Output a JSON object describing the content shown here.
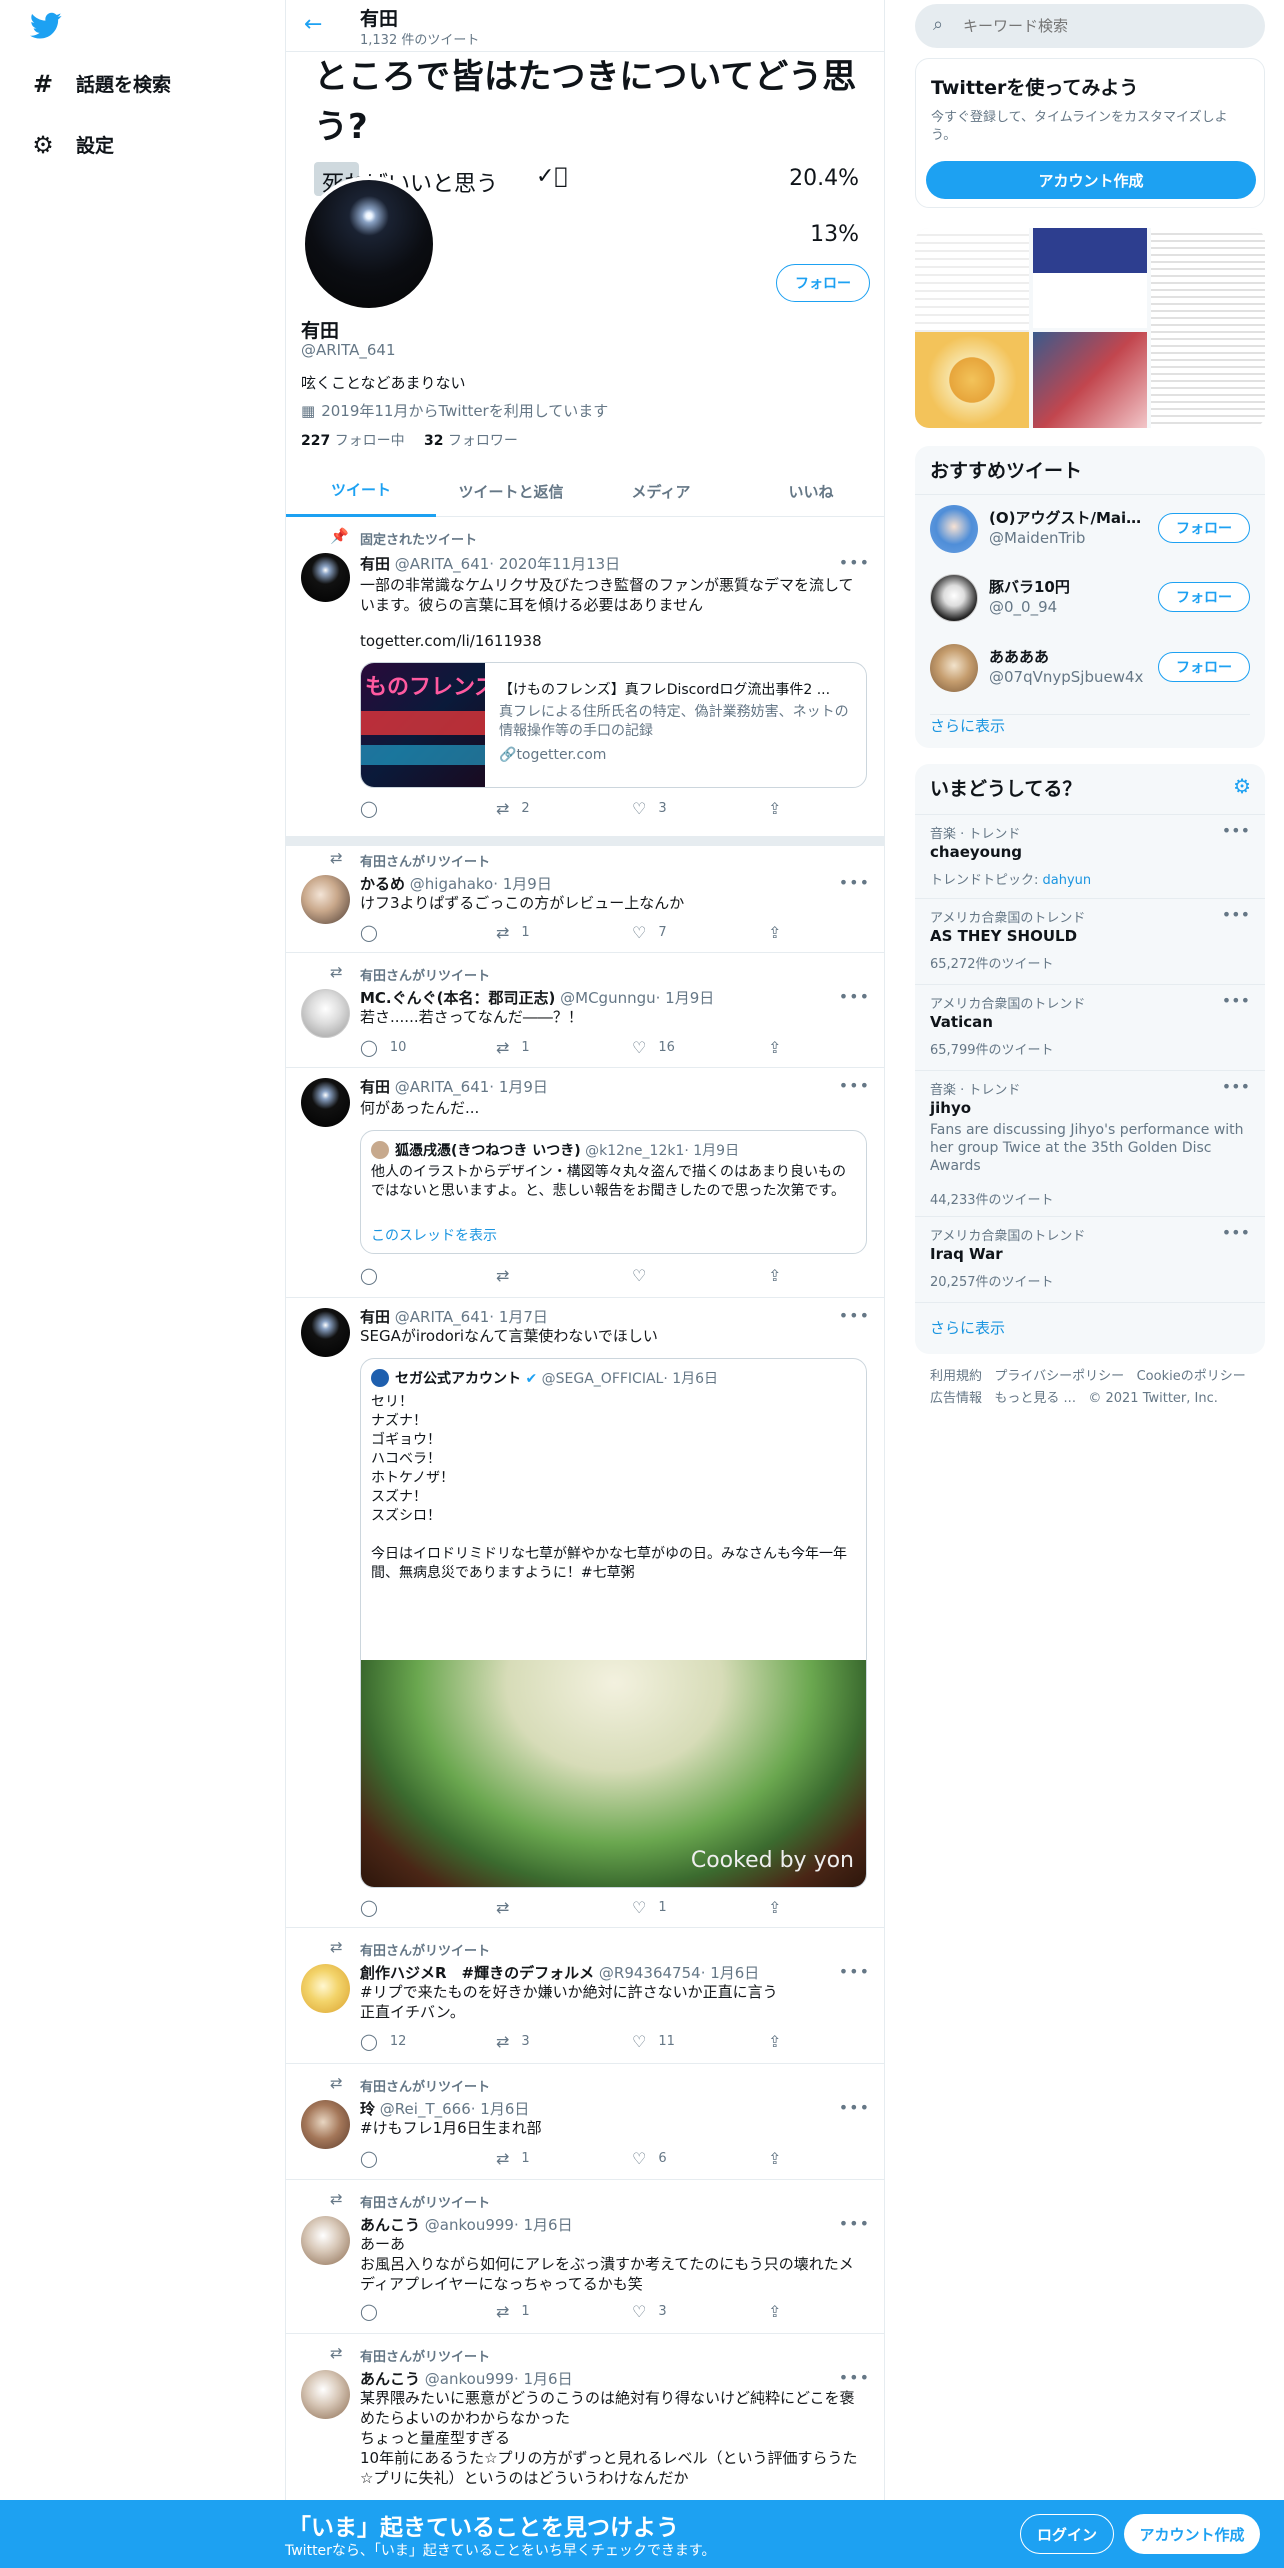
{
  "nav": {
    "explore": "話題を検索",
    "settings": "設定"
  },
  "header": {
    "name": "有田",
    "tweet_count": "1,132 件のツイート"
  },
  "poll": {
    "question": "ところで皆はたつきについてどう思う?",
    "options": [
      {
        "label": "死ねばいいと思う",
        "percent": "20.4%",
        "fraction": 0.204,
        "chosen": true
      },
      {
        "label": "",
        "percent": "13%",
        "fraction": 0.13,
        "chosen": false
      }
    ]
  },
  "profile": {
    "name": "有田",
    "handle": "@ARITA_641",
    "bio": "呟くことなどあまりない",
    "joined": "2019年11月からTwitterを利用しています",
    "following_count": "227",
    "following_label": "フォロー中",
    "followers_count": "32",
    "followers_label": "フォロワー",
    "follow_button": "フォロー"
  },
  "tabs": [
    "ツイート",
    "ツイートと返信",
    "メディア",
    "いいね"
  ],
  "tweets": {
    "t1": {
      "context": "固定されたツイート",
      "name": "有田",
      "handle": "@ARITA_641",
      "date": "· 2020年11月13日",
      "text": "一部の非常識なケムリクサ及びたつき監督のファンが悪質なデマを流しています。彼らの言葉に耳を傾ける必要はありません",
      "link": "togetter.com/li/1611938",
      "card": {
        "title": "【けものフレンズ】真フレDiscordログ流出事件2 ...",
        "desc": "真フレによる住所氏名の特定、偽計業務妨害、ネットの情報操作等の手口の記録",
        "domain": "togetter.com",
        "thumb_text": "ものフレンズ"
      },
      "reply": "",
      "retweet": "2",
      "like": "3"
    },
    "t2": {
      "context": "有田さんがリツイート",
      "name": "かるめ",
      "handle": "@higahako",
      "date": "· 1月9日",
      "text": "けフ3よりぱずるごっこの方がレビュー上なんか",
      "reply": "",
      "retweet": "1",
      "like": "7"
    },
    "t3": {
      "context": "有田さんがリツイート",
      "name": "MC.ぐんぐ(本名：郡司正志)",
      "handle": "@MCgunngu",
      "date": "· 1月9日",
      "text": "若さ......若さってなんだ――？！",
      "reply": "10",
      "retweet": "1",
      "like": "16"
    },
    "t4": {
      "name": "有田",
      "handle": "@ARITA_641",
      "date": "· 1月9日",
      "text": "何があったんだ...",
      "quote": {
        "name": "狐憑戌憑(きつねつき いつき)",
        "handle": "@k12ne_12k1",
        "date": "· 1月9日",
        "text": "他人のイラストからデザイン・構図等々丸々盗んで描くのはあまり良いものではないと思いますよ。と、悲しい報告をお聞きしたので思った次第です。",
        "thread": "このスレッドを表示"
      },
      "reply": "",
      "retweet": "",
      "like": ""
    },
    "t5": {
      "name": "有田",
      "handle": "@ARITA_641",
      "date": "· 1月7日",
      "text": "SEGAがirodoriなんて言葉使わないでほしい",
      "quote": {
        "name": "セガ公式アカウント",
        "handle": "@SEGA_OFFICIAL",
        "date": "· 1月6日",
        "lines": [
          "セリ！",
          "ナズナ！",
          "ゴギョウ！",
          "ハコベラ！",
          "ホトケノザ！",
          "スズナ！",
          "スズシロ！",
          "",
          "今日はイロドリミドリな七草が鮮やかな七草がゆの日。みなさんも今年一年間、無病息災でありますように！#七草粥"
        ],
        "watermark": "Cooked by yon"
      },
      "reply": "",
      "retweet": "",
      "like": "1"
    },
    "t6": {
      "context": "有田さんがリツイート",
      "name": "創作ハジメR　#輝きのデフォルメ",
      "handle": "@R94364754",
      "date": "· 1月6日",
      "hashtag": "#リプで来たものを好きか嫌いか絶対に許さないか正直に言う",
      "text": "正直イチバン。",
      "reply": "12",
      "retweet": "3",
      "like": "11"
    },
    "t7": {
      "context": "有田さんがリツイート",
      "name": "玲",
      "handle": "@Rei_T_666",
      "date": "· 1月6日",
      "hashtag": "#けもフレ1月6日生まれ部",
      "reply": "",
      "retweet": "1",
      "like": "6"
    },
    "t8": {
      "context": "有田さんがリツイート",
      "name": "あんこう",
      "handle": "@ankou999",
      "date": "· 1月6日",
      "lines": [
        "あーあ",
        "お風呂入りながら如何にアレをぶっ潰すか考えてたのにもう只の壊れたメディアプレイヤーになっちゃってるかも笑"
      ],
      "reply": "",
      "retweet": "1",
      "like": "3"
    },
    "t9": {
      "context": "有田さんがリツイート",
      "name": "あんこう",
      "handle": "@ankou999",
      "date": "· 1月6日",
      "lines": [
        "某界隈みたいに悪意がどうのこうのは絶対有り得ないけど純粋にどこを褒めたらよいのかわからなかった",
        "ちょっと量産型すぎる",
        "10年前にあるうた☆プリの方がずっと見れるレベル（という評価すらうた☆プリに失礼）というのはどういうわけなんだか"
      ]
    }
  },
  "search": {
    "placeholder": "キーワード検索"
  },
  "signup": {
    "title": "Twitterを使ってみよう",
    "desc": "今すぐ登録して、タイムラインをカスタマイズしよう。",
    "button": "アカウント作成"
  },
  "recommended": {
    "title": "おすすめツイート",
    "users": [
      {
        "name": "(O)アウグスト/Maide...",
        "handle": "@MaidenTrib",
        "button": "フォロー"
      },
      {
        "name": "豚バラ10円",
        "handle": "@0_0_94",
        "button": "フォロー"
      },
      {
        "name": "ああああ",
        "handle": "@07qVnypSjbuew4x",
        "button": "フォロー"
      }
    ],
    "more": "さらに表示"
  },
  "trends": {
    "title": "いまどうしてる？",
    "items": [
      {
        "context": "音楽 · トレンド",
        "name": "chaeyoung",
        "extra_label": "トレンドトピック: ",
        "extra_link": "dahyun",
        "count": ""
      },
      {
        "context": "アメリカ合衆国のトレンド",
        "name": "AS THEY SHOULD",
        "count": "65,272件のツイート"
      },
      {
        "context": "アメリカ合衆国のトレンド",
        "name": "Vatican",
        "count": "65,799件のツイート"
      },
      {
        "context": "音楽 · トレンド",
        "name": "jihyo",
        "desc": "Fans are discussing Jihyo's performance with her group Twice at the 35th Golden Disc Awards",
        "count": "44,233件のツイート"
      },
      {
        "context": "アメリカ合衆国のトレンド",
        "name": "Iraq War",
        "count": "20,257件のツイート"
      }
    ],
    "more": "さらに表示"
  },
  "footer": {
    "terms": "利用規約",
    "privacy": "プライバシーポリシー",
    "cookie": "Cookieのポリシー",
    "ads": "広告情報",
    "more": "もっと見る ...",
    "copyright": "© 2021 Twitter, Inc."
  },
  "banner": {
    "title": "「いま」起きていることを見つけよう",
    "subtitle": "Twitterなら、「いま」起きていることをいち早くチェックできます。",
    "login": "ログイン",
    "signup": "アカウント作成"
  },
  "colors": {
    "accent": "#1da1f2",
    "link": "#1b95e0",
    "banner": "#1da1f2",
    "border": "#e6ecf0"
  }
}
